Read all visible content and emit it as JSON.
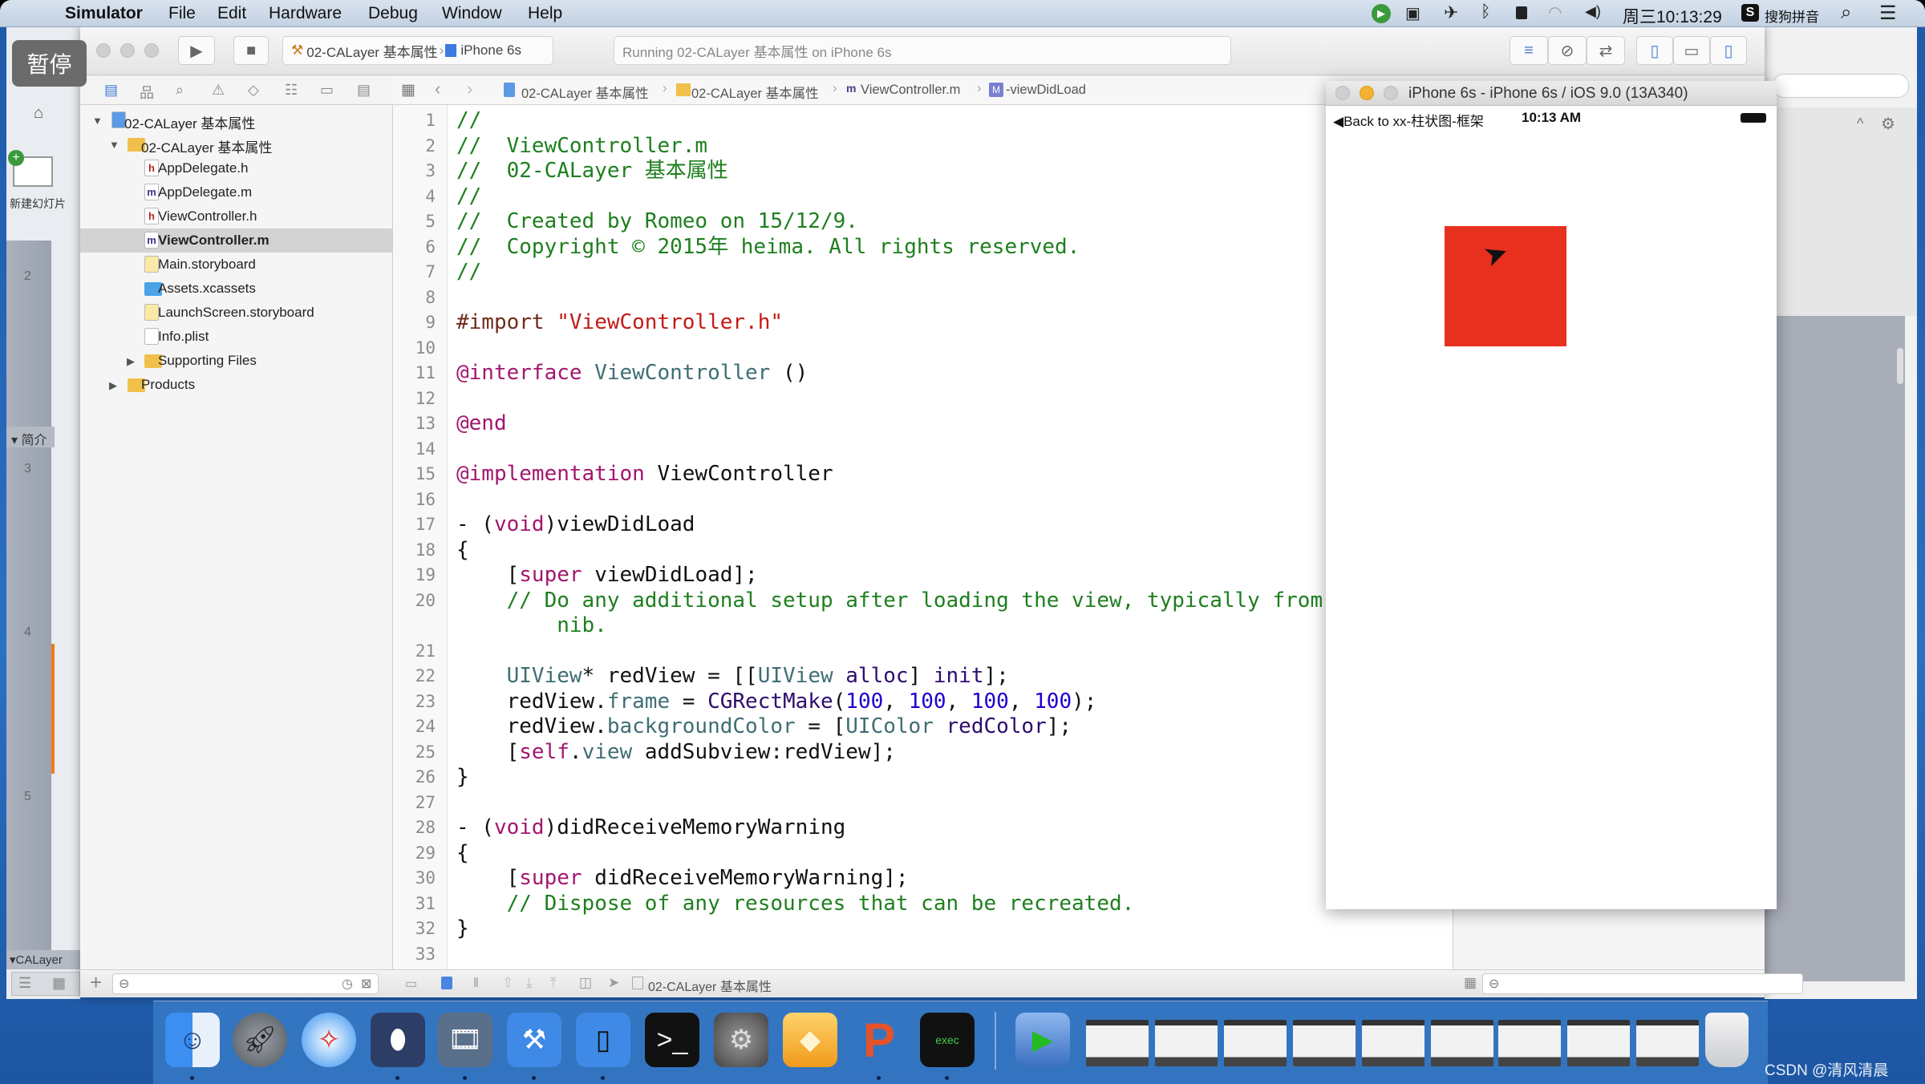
{
  "menubar": {
    "app": "Simulator",
    "items": [
      "File",
      "Edit",
      "Hardware",
      "Debug",
      "Window",
      "Help"
    ],
    "clock": "周三10:13:29",
    "input_method": "搜狗拼音",
    "status_icons": [
      "app-icon",
      "screen-record-icon",
      "flight-icon",
      "bluetooth-icon",
      "lock-icon",
      "wifi-icon",
      "volume-icon"
    ]
  },
  "overlay": {
    "pause_label": "暂停"
  },
  "keynote": {
    "new_slide_label": "新建幻灯片",
    "sections": [
      "简介",
      "CALayer"
    ],
    "slide_numbers": [
      "2",
      "3",
      "4",
      "5"
    ],
    "accent": "#f07d1a"
  },
  "toolbar": {
    "scheme": "02-CALayer 基本属性",
    "device": "iPhone 6s",
    "activity": "Running 02-CALayer 基本属性 on iPhone 6s"
  },
  "jumpbar": {
    "project": "02-CALayer 基本属性",
    "group": "02-CALayer 基本属性",
    "file": "ViewController.m",
    "method_badge": "M",
    "method": "-viewDidLoad"
  },
  "navigator": {
    "items": [
      {
        "label": "02-CALayer 基本属性",
        "kind": "project",
        "level": 0,
        "expanded": true
      },
      {
        "label": "02-CALayer 基本属性",
        "kind": "folder",
        "level": 1,
        "expanded": true
      },
      {
        "label": "AppDelegate.h",
        "kind": "h",
        "level": 2
      },
      {
        "label": "AppDelegate.m",
        "kind": "m",
        "level": 2
      },
      {
        "label": "ViewController.h",
        "kind": "h",
        "level": 2
      },
      {
        "label": "ViewController.m",
        "kind": "m",
        "level": 2,
        "selected": true
      },
      {
        "label": "Main.storyboard",
        "kind": "storyboard",
        "level": 2
      },
      {
        "label": "Assets.xcassets",
        "kind": "assets",
        "level": 2
      },
      {
        "label": "LaunchScreen.storyboard",
        "kind": "storyboard",
        "level": 2
      },
      {
        "label": "Info.plist",
        "kind": "plist",
        "level": 2
      },
      {
        "label": "Supporting Files",
        "kind": "folder",
        "level": 2,
        "expanded": false
      },
      {
        "label": "Products",
        "kind": "folder",
        "level": 1,
        "expanded": false
      }
    ]
  },
  "editor": {
    "lines": [
      {
        "n": "1",
        "t": [
          [
            "c",
            "//"
          ]
        ]
      },
      {
        "n": "2",
        "t": [
          [
            "c",
            "//  ViewController.m"
          ]
        ]
      },
      {
        "n": "3",
        "t": [
          [
            "c",
            "//  02-CALayer 基本属性"
          ]
        ]
      },
      {
        "n": "4",
        "t": [
          [
            "c",
            "//"
          ]
        ]
      },
      {
        "n": "5",
        "t": [
          [
            "c",
            "//  Created by Romeo on 15/12/9."
          ]
        ]
      },
      {
        "n": "6",
        "t": [
          [
            "c",
            "//  Copyright © 2015年 heima. All rights reserved."
          ]
        ]
      },
      {
        "n": "7",
        "t": [
          [
            "c",
            "//"
          ]
        ]
      },
      {
        "n": "8",
        "t": []
      },
      {
        "n": "9",
        "t": [
          [
            "p",
            "#import "
          ],
          [
            "s",
            "\"ViewController.h\""
          ]
        ]
      },
      {
        "n": "10",
        "t": []
      },
      {
        "n": "11",
        "t": [
          [
            "k",
            "@interface "
          ],
          [
            "t",
            "ViewController"
          ],
          [
            "x",
            " ()"
          ]
        ]
      },
      {
        "n": "12",
        "t": []
      },
      {
        "n": "13",
        "t": [
          [
            "k",
            "@end"
          ]
        ]
      },
      {
        "n": "14",
        "t": []
      },
      {
        "n": "15",
        "t": [
          [
            "k",
            "@implementation "
          ],
          [
            "x",
            "ViewController"
          ]
        ]
      },
      {
        "n": "16",
        "t": []
      },
      {
        "n": "17",
        "t": [
          [
            "x",
            "- ("
          ],
          [
            "k",
            "void"
          ],
          [
            "x",
            ")viewDidLoad"
          ]
        ]
      },
      {
        "n": "18",
        "t": [
          [
            "x",
            "{"
          ]
        ]
      },
      {
        "n": "19",
        "t": [
          [
            "x",
            "    ["
          ],
          [
            "k",
            "super"
          ],
          [
            "x",
            " viewDidLoad];"
          ]
        ]
      },
      {
        "n": "20",
        "t": [
          [
            "x",
            "    "
          ],
          [
            "c",
            "// Do any additional setup after loading the view, typically from a"
          ]
        ]
      },
      {
        "n": "",
        "t": [
          [
            "c",
            "        nib."
          ]
        ]
      },
      {
        "n": "21",
        "t": []
      },
      {
        "n": "22",
        "t": [
          [
            "x",
            "    "
          ],
          [
            "t",
            "UIView"
          ],
          [
            "x",
            "* redView = [["
          ],
          [
            "t",
            "UIView"
          ],
          [
            "x",
            " "
          ],
          [
            "m",
            "alloc"
          ],
          [
            "x",
            "] "
          ],
          [
            "m",
            "init"
          ],
          [
            "x",
            "];"
          ]
        ]
      },
      {
        "n": "23",
        "t": [
          [
            "x",
            "    redView."
          ],
          [
            "m2",
            "frame"
          ],
          [
            "x",
            " = "
          ],
          [
            "m",
            "CGRectMake"
          ],
          [
            "x",
            "("
          ],
          [
            "n",
            "100"
          ],
          [
            "x",
            ", "
          ],
          [
            "n",
            "100"
          ],
          [
            "x",
            ", "
          ],
          [
            "n",
            "100"
          ],
          [
            "x",
            ", "
          ],
          [
            "n",
            "100"
          ],
          [
            "x",
            ");"
          ]
        ]
      },
      {
        "n": "24",
        "t": [
          [
            "x",
            "    redView."
          ],
          [
            "m2",
            "backgroundColor"
          ],
          [
            "x",
            " = ["
          ],
          [
            "t",
            "UIColor"
          ],
          [
            "x",
            " "
          ],
          [
            "m",
            "redColor"
          ],
          [
            "x",
            "];"
          ]
        ]
      },
      {
        "n": "25",
        "t": [
          [
            "x",
            "    ["
          ],
          [
            "k",
            "self"
          ],
          [
            "x",
            "."
          ],
          [
            "m2",
            "view"
          ],
          [
            "x",
            " addSubview:redView];"
          ]
        ]
      },
      {
        "n": "26",
        "t": [
          [
            "x",
            "}"
          ]
        ]
      },
      {
        "n": "27",
        "t": []
      },
      {
        "n": "28",
        "t": [
          [
            "x",
            "- ("
          ],
          [
            "k",
            "void"
          ],
          [
            "x",
            ")didReceiveMemoryWarning"
          ]
        ]
      },
      {
        "n": "29",
        "t": [
          [
            "x",
            "{"
          ]
        ]
      },
      {
        "n": "30",
        "t": [
          [
            "x",
            "    ["
          ],
          [
            "k",
            "super"
          ],
          [
            "x",
            " didReceiveMemoryWarning];"
          ]
        ]
      },
      {
        "n": "31",
        "t": [
          [
            "x",
            "    "
          ],
          [
            "c",
            "// Dispose of any resources that can be recreated."
          ]
        ]
      },
      {
        "n": "32",
        "t": [
          [
            "x",
            "}"
          ]
        ]
      },
      {
        "n": "33",
        "t": []
      }
    ]
  },
  "bottombar": {
    "target": "02-CALayer 基本属性"
  },
  "simulator": {
    "title": "iPhone 6s - iPhone 6s / iOS 9.0 (13A340)",
    "back_label": "Back to xx-柱状图-框架",
    "time": "10:13 AM",
    "red_view_color": "#e8301f"
  },
  "dock": {
    "apps": [
      "finder",
      "launchpad",
      "safari",
      "mouse-app",
      "photo-slideshow",
      "xcode",
      "simulator",
      "terminal",
      "system-preferences",
      "sketch",
      "presentation-app",
      "console"
    ],
    "others": [
      "media-center",
      "preview-window",
      "window-1",
      "window-2",
      "window-3",
      "window-4",
      "window-5",
      "window-6",
      "window-7",
      "window-8",
      "trash"
    ]
  },
  "watermark": "CSDN @清风清晨"
}
